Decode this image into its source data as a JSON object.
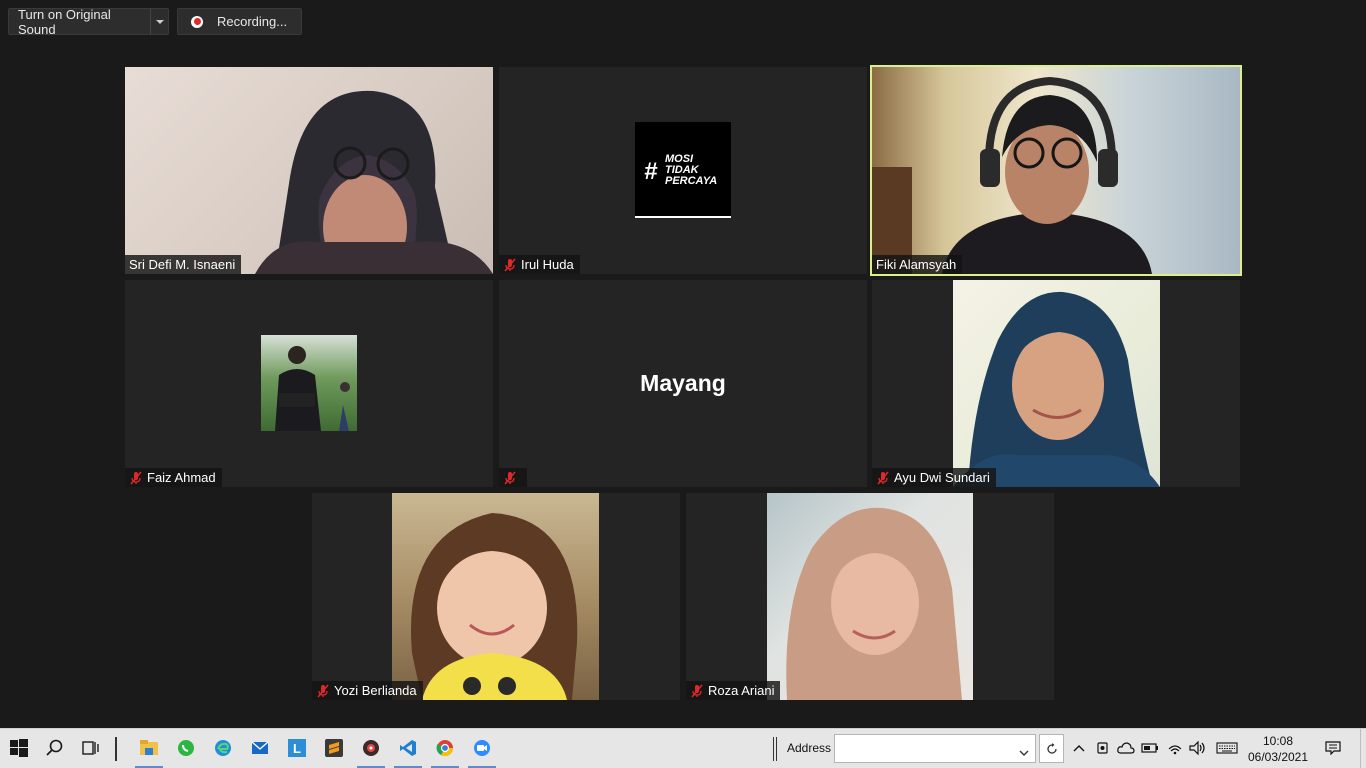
{
  "toolbar": {
    "original_sound_label": "Turn on Original Sound",
    "recording_label": "Recording..."
  },
  "participants": [
    {
      "name": "Sri Defi M. Isnaeni",
      "muted": false,
      "active": false,
      "feed": "video"
    },
    {
      "name": "Irul Huda",
      "muted": true,
      "active": false,
      "feed": "profile-picture",
      "profile_text": [
        "#",
        "MOSI",
        "TIDAK",
        "PERCAYA"
      ]
    },
    {
      "name": "Fiki Alamsyah",
      "muted": false,
      "active": true,
      "feed": "video"
    },
    {
      "name": "Faiz Ahmad",
      "muted": true,
      "active": false,
      "feed": "profile-picture"
    },
    {
      "name": "",
      "muted": true,
      "active": false,
      "feed": "name-only",
      "display_name": "Mayang"
    },
    {
      "name": "Ayu Dwi Sundari",
      "muted": true,
      "active": false,
      "feed": "video"
    },
    {
      "name": "Yozi Berlianda",
      "muted": true,
      "active": false,
      "feed": "video"
    },
    {
      "name": "Roza Ariani",
      "muted": true,
      "active": false,
      "feed": "video"
    }
  ],
  "taskbar": {
    "address_label": "Address",
    "address_value": "",
    "time": "10:08",
    "date": "06/03/2021"
  },
  "colors": {
    "background": "#1a1a1a",
    "tile": "#242424",
    "active_speaker_border": "#dbf08a",
    "mute_icon": "#e02828",
    "taskbar": "#e6e6e6"
  }
}
